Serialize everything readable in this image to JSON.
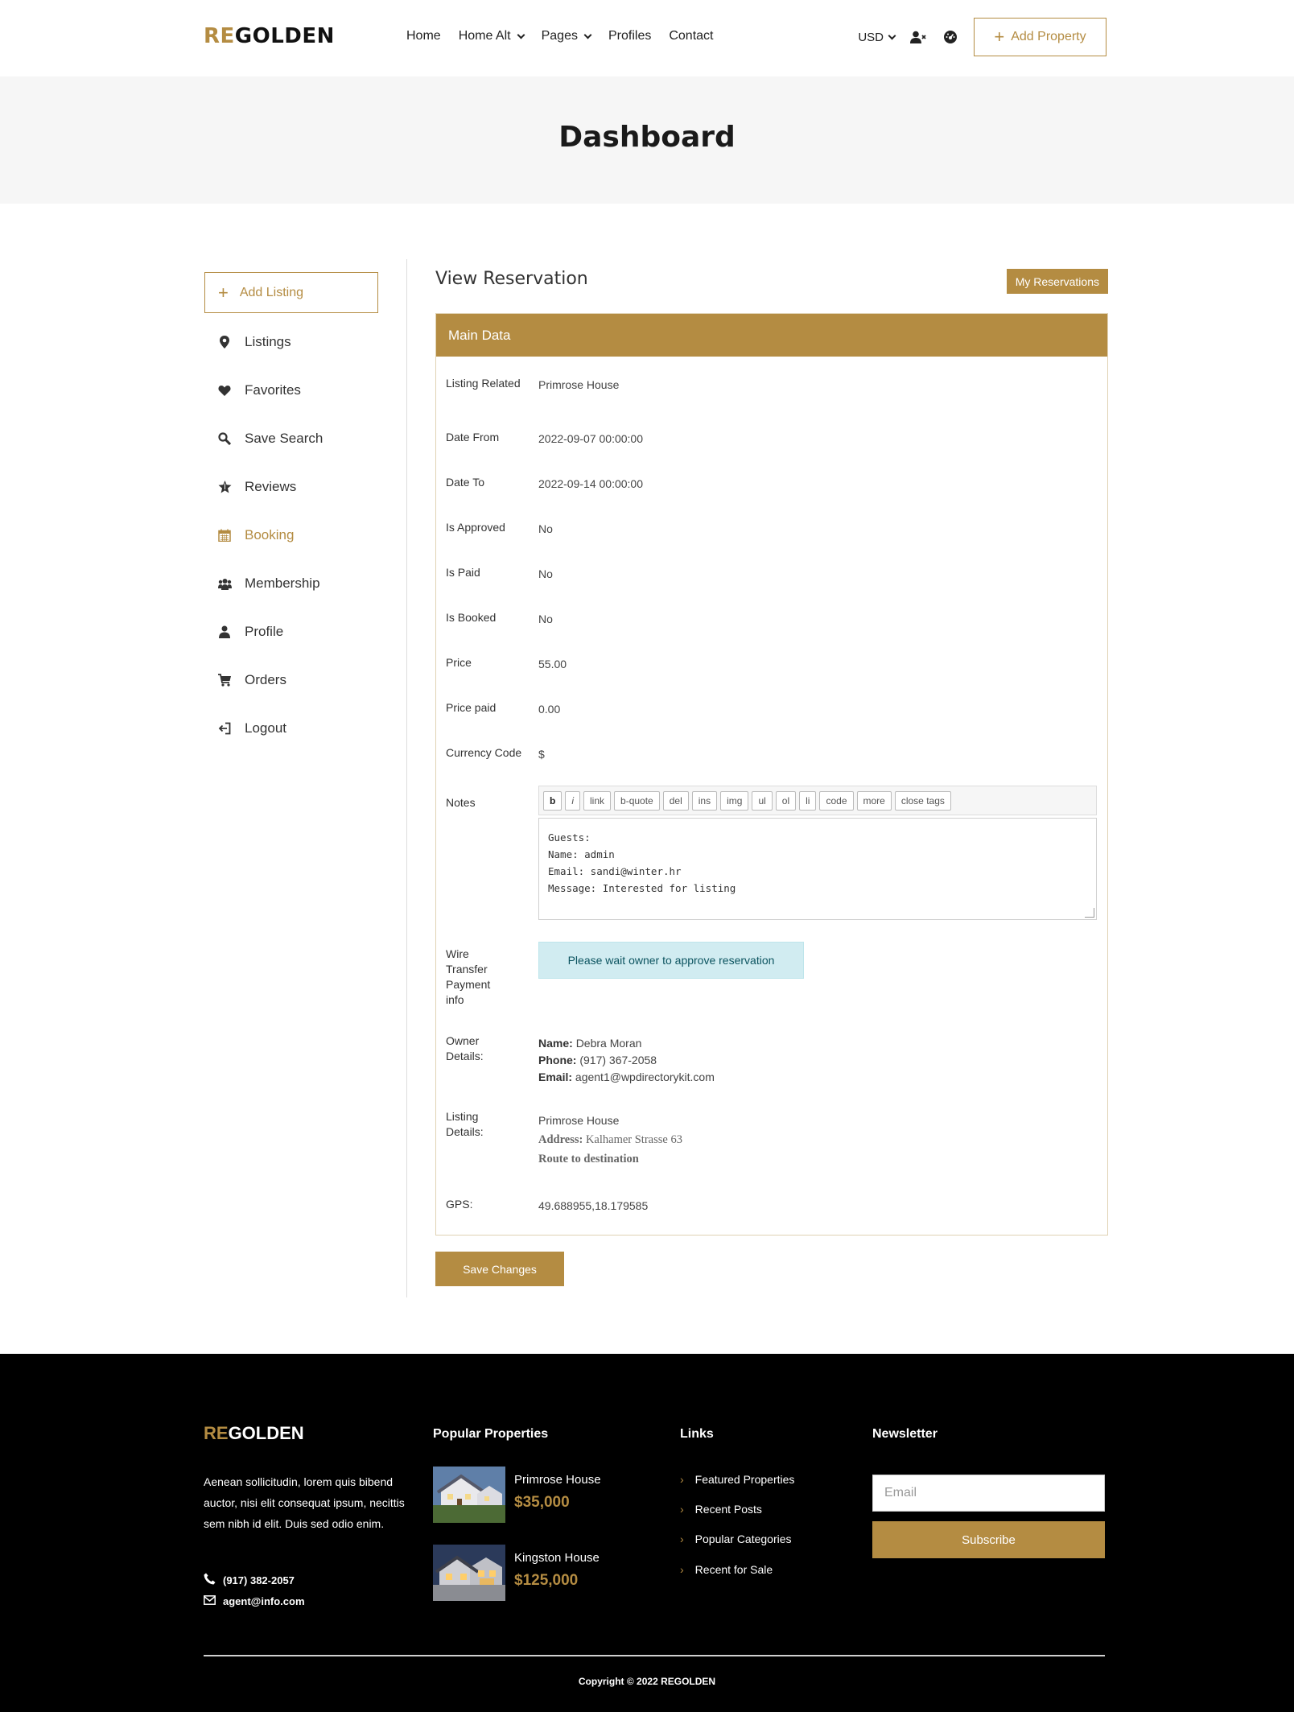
{
  "header": {
    "logo_accent": "RE",
    "logo_rest": "GOLDEN",
    "nav": [
      {
        "label": "Home",
        "dropdown": false
      },
      {
        "label": "Home Alt",
        "dropdown": true
      },
      {
        "label": "Pages",
        "dropdown": true
      },
      {
        "label": "Profiles",
        "dropdown": false
      },
      {
        "label": "Contact",
        "dropdown": false
      }
    ],
    "currency": "USD",
    "add_property": "Add Property"
  },
  "banner": {
    "title": "Dashboard"
  },
  "sidebar": {
    "add_listing": "Add Listing",
    "items": [
      {
        "label": "Listings",
        "icon": "map-pin-icon"
      },
      {
        "label": "Favorites",
        "icon": "heart-icon"
      },
      {
        "label": "Save Search",
        "icon": "search-icon"
      },
      {
        "label": "Reviews",
        "icon": "star-icon"
      },
      {
        "label": "Booking",
        "icon": "calendar-icon",
        "active": true
      },
      {
        "label": "Membership",
        "icon": "group-icon"
      },
      {
        "label": "Profile",
        "icon": "user-icon"
      },
      {
        "label": "Orders",
        "icon": "cart-icon"
      },
      {
        "label": "Logout",
        "icon": "logout-icon"
      }
    ]
  },
  "main": {
    "title": "View Reservation",
    "my_reservations": "My Reservations",
    "panel_title": "Main Data",
    "fields": {
      "listing_related": {
        "label": "Listing Related",
        "value": "Primrose House"
      },
      "date_from": {
        "label": "Date From",
        "value": "2022-09-07 00:00:00"
      },
      "date_to": {
        "label": "Date To",
        "value": "2022-09-14 00:00:00"
      },
      "is_approved": {
        "label": "Is Approved",
        "value": "No"
      },
      "is_paid": {
        "label": "Is Paid",
        "value": "No"
      },
      "is_booked": {
        "label": "Is Booked",
        "value": "No"
      },
      "price": {
        "label": "Price",
        "value": "55.00"
      },
      "price_paid": {
        "label": "Price paid",
        "value": "0.00"
      },
      "currency_code": {
        "label": "Currency Code",
        "value": "$"
      },
      "notes": {
        "label": "Notes"
      },
      "wire": {
        "label": "Wire Transfer Payment info",
        "alert": "Please wait owner to approve reservation"
      },
      "owner": {
        "label": "Owner Details:",
        "name_label": "Name:",
        "name": "Debra Moran",
        "phone_label": "Phone:",
        "phone": "(917) 367-2058",
        "email_label": "Email:",
        "email": "agent1@wpdirectorykit.com"
      },
      "listing_details": {
        "label": "Listing Details:",
        "name": "Primrose House",
        "address_label": "Address:",
        "address": "Kalhamer Strasse 63",
        "route": "Route to destination"
      },
      "gps": {
        "label": "GPS:",
        "value": "49.688955,18.179585"
      }
    },
    "toolbar": [
      "b",
      "i",
      "link",
      "b-quote",
      "del",
      "ins",
      "img",
      "ul",
      "ol",
      "li",
      "code",
      "more",
      "close tags"
    ],
    "notes_lines": [
      "Guests:",
      "Name: admin",
      "Email: sandi@winter.hr",
      "Message: Interested for listing"
    ],
    "save_button": "Save Changes"
  },
  "footer": {
    "logo_accent": "RE",
    "logo_rest": "GOLDEN",
    "about": "Aenean sollicitudin, lorem quis bibend auctor, nisi elit consequat ipsum, necittis sem nibh id elit. Duis sed odio enim.",
    "phone": "(917) 382-2057",
    "email": "agent@info.com",
    "popular_title": "Popular Properties",
    "properties": [
      {
        "name": "Primrose House",
        "price": "$35,000"
      },
      {
        "name": "Kingston House",
        "price": "$125,000"
      }
    ],
    "links_title": "Links",
    "links": [
      "Featured Properties",
      "Recent Posts",
      "Popular Categories",
      "Recent for Sale"
    ],
    "newsletter_title": "Newsletter",
    "email_placeholder": "Email",
    "subscribe": "Subscribe",
    "copyright": "Copyright © 2022 REGOLDEN"
  },
  "colors": {
    "accent": "#b48c42",
    "alert_bg": "#d1ecf1",
    "footer_bg": "#000000"
  }
}
